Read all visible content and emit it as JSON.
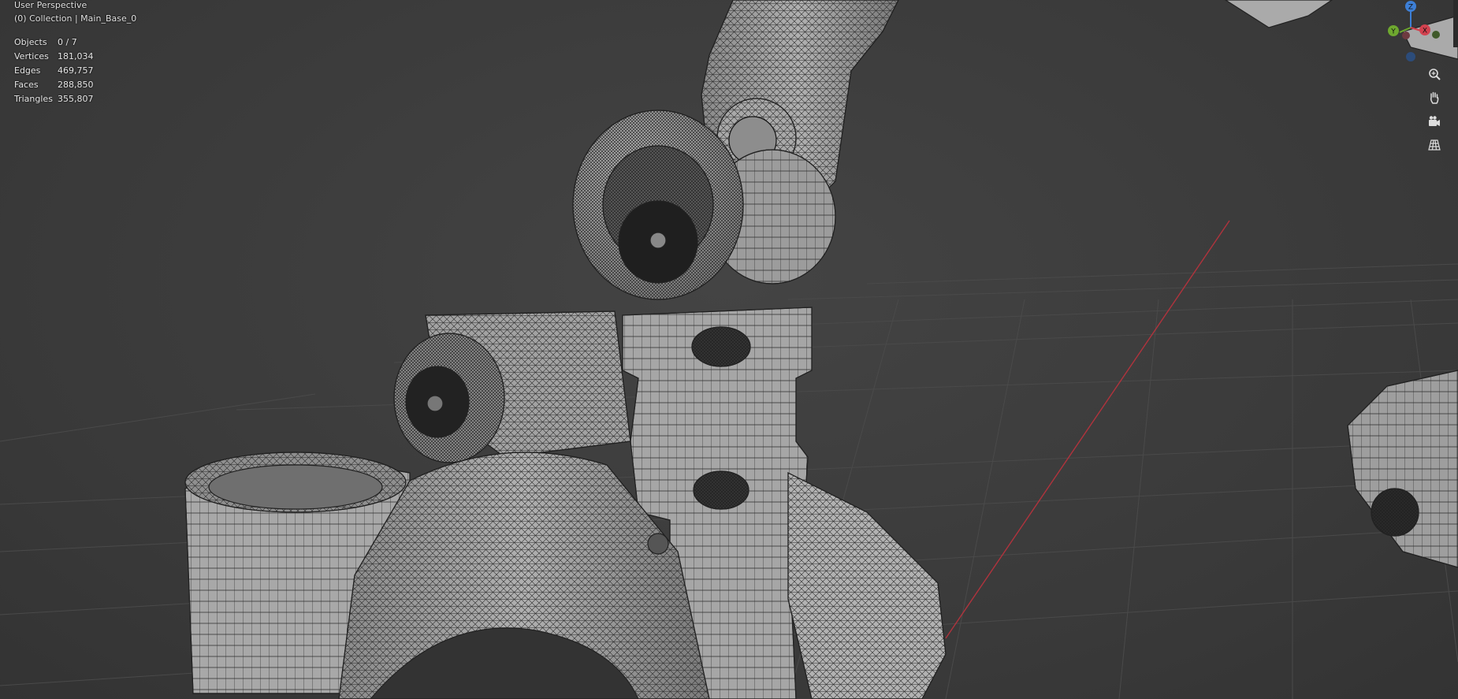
{
  "viewport": {
    "mode_label": "User Perspective",
    "collection_label": "(0) Collection | Main_Base_0"
  },
  "stats": [
    {
      "label": "Objects",
      "value": "0 / 7"
    },
    {
      "label": "Vertices",
      "value": "181,034"
    },
    {
      "label": "Edges",
      "value": "469,757"
    },
    {
      "label": "Faces",
      "value": "288,850"
    },
    {
      "label": "Triangles",
      "value": "355,807"
    }
  ],
  "gizmo": {
    "z_label": "Z",
    "y_label": "Y",
    "x_label": "X",
    "colors": {
      "z": "#3d7fd6",
      "y": "#6ea82f",
      "x": "#d2424f"
    }
  },
  "nav_icons": [
    "zoom-icon",
    "pan-hand-icon",
    "camera-icon",
    "grid-perspective-icon"
  ],
  "colors": {
    "background": "#3d3d3d",
    "grid": "#4a4a4a",
    "x_axis": "#b0333d",
    "mesh_fill": "#9a9a9a",
    "wire": "#2a2a2a"
  }
}
